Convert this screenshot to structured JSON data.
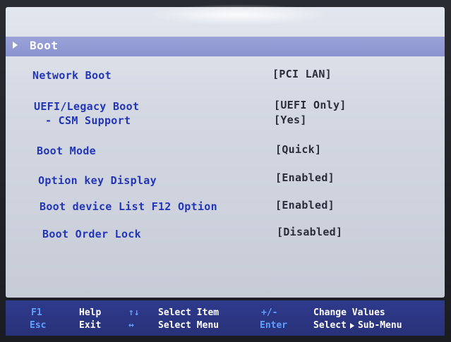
{
  "section": {
    "title": "Boot"
  },
  "settings": [
    {
      "label": "Network Boot",
      "value": "[PCI LAN]"
    },
    {
      "label": "UEFI/Legacy Boot",
      "value": "[UEFI Only]"
    },
    {
      "label": "- CSM Support",
      "value": "[Yes]"
    },
    {
      "label": "Boot Mode",
      "value": "[Quick]"
    },
    {
      "label": "Option key Display",
      "value": "[Enabled]"
    },
    {
      "label": "Boot device List F12 Option",
      "value": "[Enabled]"
    },
    {
      "label": "Boot Order Lock",
      "value": "[Disabled]"
    }
  ],
  "footer": {
    "row1": [
      {
        "key": "F1",
        "desc": "Help"
      },
      {
        "key": "↑↓",
        "desc": "Select Item"
      },
      {
        "key": "+/-",
        "desc": "Change Values"
      }
    ],
    "row2": [
      {
        "key": "Esc",
        "desc": "Exit"
      },
      {
        "key": "↔",
        "desc": "Select Menu"
      },
      {
        "key": "Enter",
        "desc_before": "Select",
        "desc_after": "Sub-Menu"
      }
    ]
  },
  "colors": {
    "label": "#2336b6",
    "value": "#2a2e3a",
    "section_bar": "#8a93cf",
    "footer_bg": "#2f3a8c",
    "footer_key": "#5fa0ff"
  }
}
